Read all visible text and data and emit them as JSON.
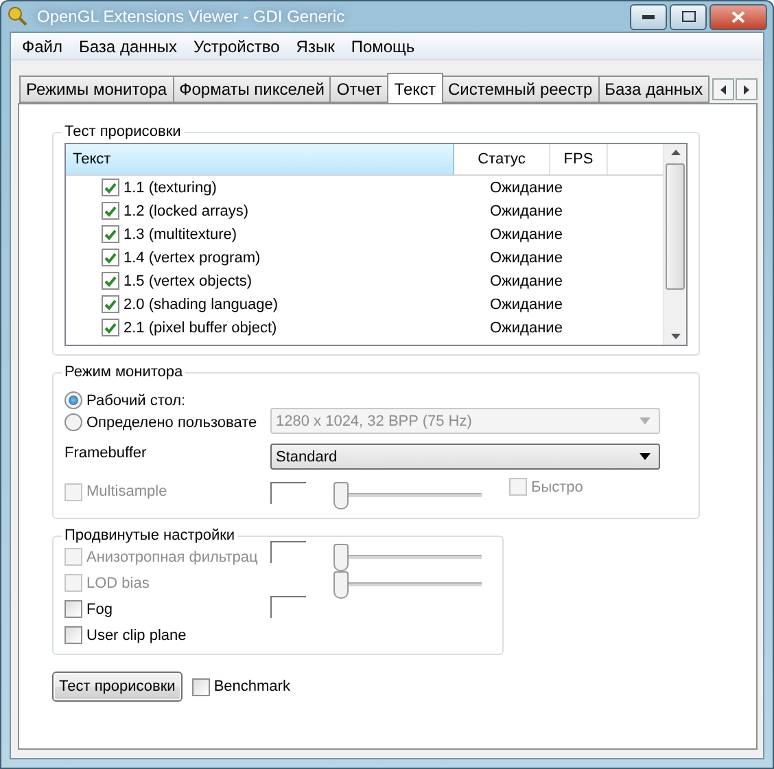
{
  "window": {
    "title": "OpenGL Extensions Viewer - GDI Generic"
  },
  "menu": [
    "Файл",
    "База данных",
    "Устройство",
    "Язык",
    "Помощь"
  ],
  "tabs": [
    {
      "label": "Режимы монитора",
      "selected": false
    },
    {
      "label": "Форматы пикселей",
      "selected": false
    },
    {
      "label": "Отчет",
      "selected": false
    },
    {
      "label": "Текст",
      "selected": true
    },
    {
      "label": "Системный реестр",
      "selected": false
    },
    {
      "label": "База данных",
      "selected": false
    }
  ],
  "render_test": {
    "title": "Тест прорисовки",
    "columns": [
      {
        "label": "Текст",
        "selected": true
      },
      {
        "label": "Статус",
        "selected": false
      },
      {
        "label": "FPS",
        "selected": false
      }
    ],
    "rows": [
      {
        "label": "1.1 (texturing)",
        "checked": true,
        "status": "Ожидание"
      },
      {
        "label": "1.2 (locked arrays)",
        "checked": true,
        "status": "Ожидание"
      },
      {
        "label": "1.3 (multitexture)",
        "checked": true,
        "status": "Ожидание"
      },
      {
        "label": "1.4 (vertex program)",
        "checked": true,
        "status": "Ожидание"
      },
      {
        "label": "1.5 (vertex objects)",
        "checked": true,
        "status": "Ожидание"
      },
      {
        "label": "2.0 (shading language)",
        "checked": true,
        "status": "Ожидание"
      },
      {
        "label": "2.1 (pixel buffer object)",
        "checked": true,
        "status": "Ожидание"
      }
    ]
  },
  "monitor_mode": {
    "title": "Режим монитора",
    "options": [
      {
        "label": "Рабочий стол:",
        "selected": true
      },
      {
        "label": "Определено пользовате",
        "selected": false
      }
    ],
    "resolution": {
      "value": "1280 x 1024, 32 BPP (75 Hz)",
      "disabled": true
    },
    "framebuffer": {
      "label": "Framebuffer",
      "value": "Standard"
    },
    "multisample": {
      "label": "Multisample",
      "checked": false,
      "disabled": true,
      "level": 0
    },
    "fast": {
      "label": "Быстро",
      "checked": false,
      "disabled": true
    }
  },
  "advanced": {
    "title": "Продвинутые настройки",
    "options": [
      {
        "label": "Анизотропная фильтрац",
        "checked": false,
        "disabled": true,
        "level": 0
      },
      {
        "label": "LOD bias",
        "checked": false,
        "disabled": true,
        "level": 0
      },
      {
        "label": "Fog",
        "checked": false,
        "disabled": false
      },
      {
        "label": "User clip plane",
        "checked": false,
        "disabled": false
      }
    ]
  },
  "run_button": "Тест прорисовки",
  "benchmark": {
    "label": "Benchmark",
    "checked": false
  }
}
